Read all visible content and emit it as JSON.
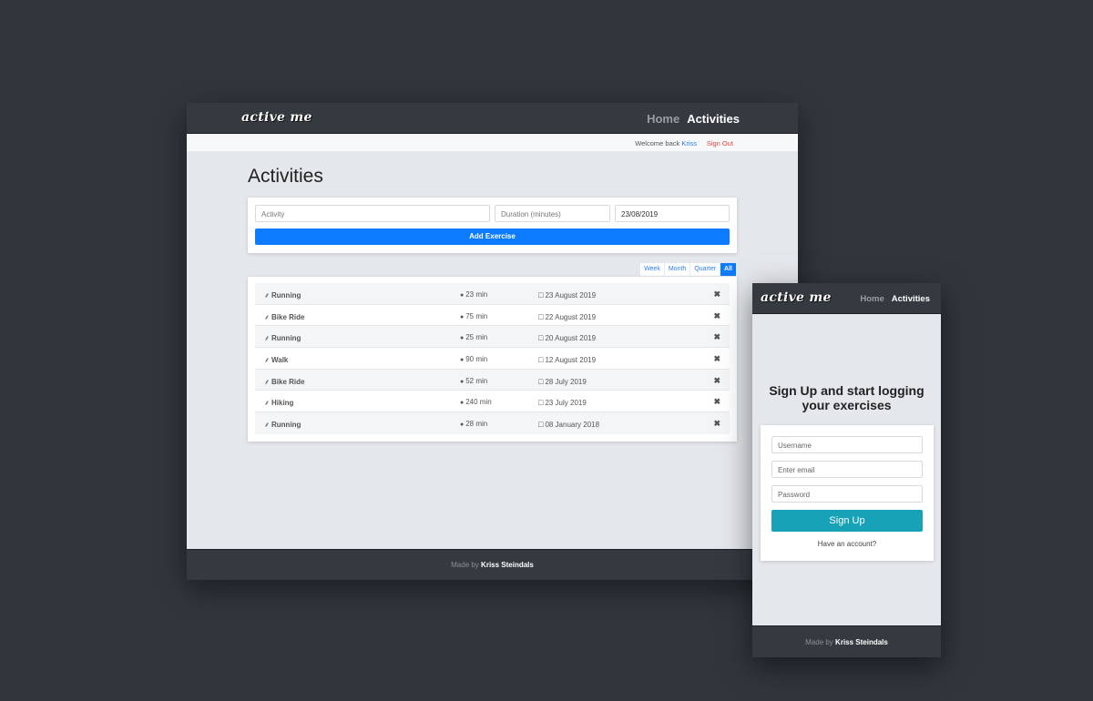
{
  "desktop": {
    "nav": {
      "logo": "active me",
      "links": [
        {
          "label": "Home",
          "active": false
        },
        {
          "label": "Activities",
          "active": true
        }
      ]
    },
    "subbar": {
      "welcome": "Welcome back",
      "username": "Kriss",
      "signout": "Sign Out"
    },
    "title": "Activities",
    "form": {
      "activity_placeholder": "Activity",
      "duration_placeholder": "Duration (minutes)",
      "date_value": "23/08/2019",
      "add_label": "Add Exercise"
    },
    "filters": [
      {
        "label": "Week",
        "active": false
      },
      {
        "label": "Month",
        "active": false
      },
      {
        "label": "Quarter",
        "active": false
      },
      {
        "label": "All",
        "active": true
      }
    ],
    "icons": {
      "activity": "running-icon",
      "duration": "stopwatch-icon",
      "date": "calendar-icon",
      "delete": "close-icon"
    },
    "activities": [
      {
        "name": "Running",
        "duration": "23 min",
        "date": "23 August 2019"
      },
      {
        "name": "Bike Ride",
        "duration": "75 min",
        "date": "22 August 2019"
      },
      {
        "name": "Running",
        "duration": "25 min",
        "date": "20 August 2019"
      },
      {
        "name": "Walk",
        "duration": "90 min",
        "date": "12 August 2019"
      },
      {
        "name": "Bike Ride",
        "duration": "52 min",
        "date": "28 July 2019"
      },
      {
        "name": "Hiking",
        "duration": "240 min",
        "date": "23 July 2019"
      },
      {
        "name": "Running",
        "duration": "28 min",
        "date": "08 January 2018"
      }
    ],
    "footer": {
      "prefix": "Made by",
      "author": "Kriss Steindals"
    }
  },
  "mobile": {
    "nav": {
      "logo": "active me",
      "links": [
        {
          "label": "Home",
          "active": false
        },
        {
          "label": "Activities",
          "active": true
        }
      ]
    },
    "title": "Sign Up and start logging your exercises",
    "form": {
      "username_placeholder": "Username",
      "email_placeholder": "Enter email",
      "password_placeholder": "Password",
      "signup_label": "Sign Up",
      "have_account": "Have an account?"
    },
    "footer": {
      "prefix": "Made by",
      "author": "Kriss Steindals"
    }
  },
  "colors": {
    "background": "#31363d",
    "navbar": "#343a40",
    "primary": "#0d7bff",
    "signup": "#17a2b8",
    "signout": "#e0443b"
  }
}
